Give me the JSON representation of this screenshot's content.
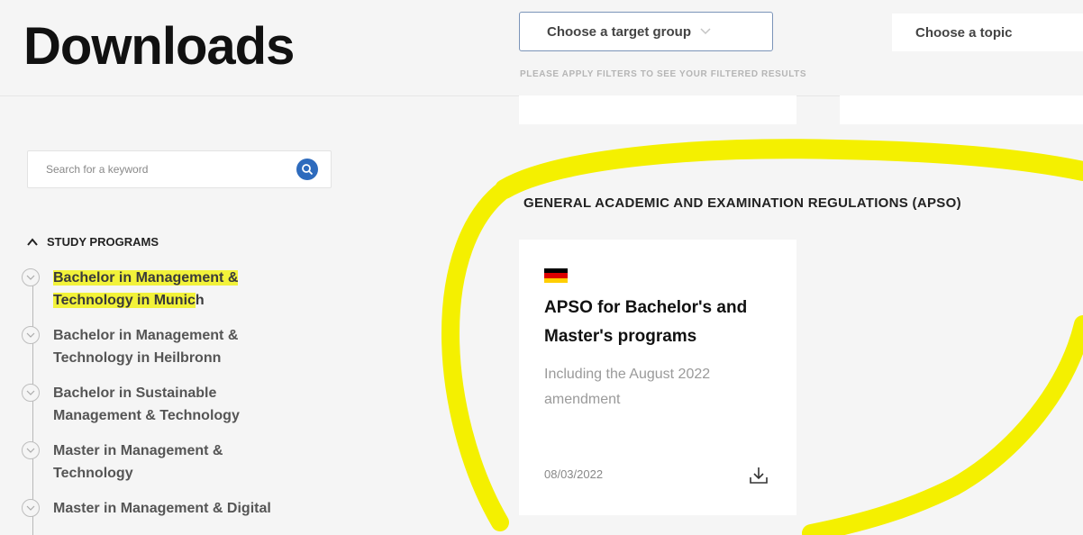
{
  "header": {
    "title": "Downloads"
  },
  "filters": {
    "target_group": "Choose a target group",
    "topic": "Choose a topic",
    "hint": "PLEASE APPLY FILTERS TO SEE YOUR FILTERED RESULTS"
  },
  "search": {
    "placeholder": "Search for a keyword",
    "icon": "search-icon"
  },
  "sidebar": {
    "section_label": "STUDY PROGRAMS",
    "section_expanded": true,
    "programs": [
      {
        "label_highlighted": "Bachelor in Management & Technology in Munic",
        "label_rest": "h",
        "active": true
      },
      {
        "label": "Bachelor in Management & Technology in Heilbronn",
        "active": false
      },
      {
        "label": "Bachelor in Sustainable Management & Technology",
        "active": false
      },
      {
        "label": "Master in Management & Technology",
        "active": false
      },
      {
        "label": "Master in Management & Digital",
        "active": false
      }
    ]
  },
  "main": {
    "section_heading": "GENERAL ACADEMIC AND EXAMINATION REGULATIONS (APSO)",
    "card": {
      "flag": "german-flag",
      "title": "APSO for Bachelor's and Master's programs",
      "description": "Including the August 2022 amendment",
      "date": "08/03/2022",
      "action_icon": "download-icon"
    }
  },
  "colors": {
    "accent_blue": "#2e6bbd",
    "highlight_yellow": "#f2f23a",
    "annotation_yellow": "#f4f000",
    "flag": [
      "#000000",
      "#dd0000",
      "#ffce00"
    ]
  }
}
